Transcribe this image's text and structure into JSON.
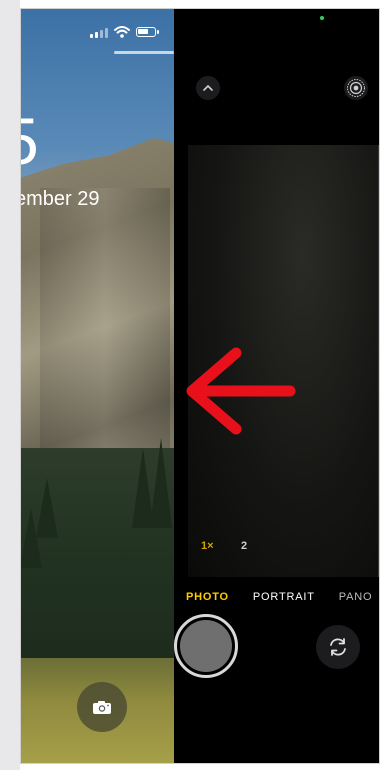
{
  "lock_screen": {
    "time": "5",
    "date": "ember 29",
    "icons": {
      "signal": "cellular-signal-icon",
      "wifi": "wifi-icon",
      "battery": "battery-icon",
      "camera": "camera-icon"
    }
  },
  "camera_app": {
    "zoom_levels": [
      "1×",
      "2"
    ],
    "modes": [
      "PHOTO",
      "PORTRAIT",
      "PANO"
    ],
    "selected_mode": "PHOTO",
    "icons": {
      "expand": "chevron-up-icon",
      "live_photo": "live-photo-icon",
      "shutter": "shutter-button",
      "flip": "flip-camera-icon"
    }
  },
  "annotation": {
    "arrow_color": "#e8101a",
    "direction": "left"
  },
  "colors": {
    "accent_yellow": "#ffcc00",
    "camera_bg": "#000000"
  }
}
